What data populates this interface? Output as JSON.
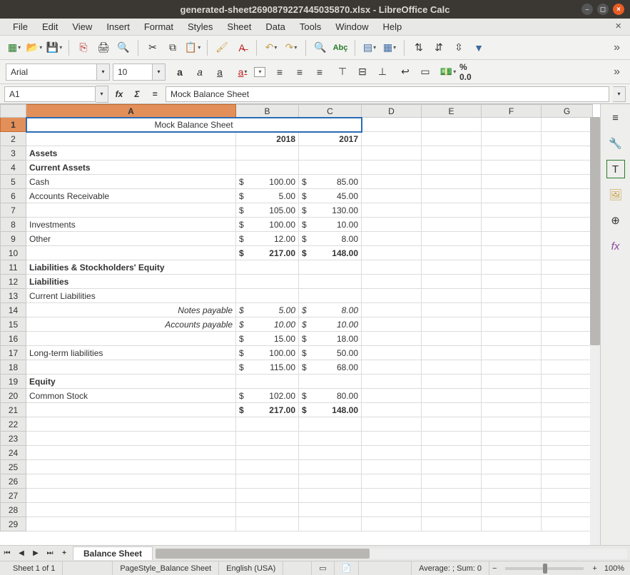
{
  "window": {
    "title": "generated-sheet2690879227445035870.xlsx - LibreOffice Calc"
  },
  "menu": {
    "file": "File",
    "edit": "Edit",
    "view": "View",
    "insert": "Insert",
    "format": "Format",
    "styles": "Styles",
    "sheet": "Sheet",
    "data": "Data",
    "tools": "Tools",
    "window": "Window",
    "help": "Help"
  },
  "font": {
    "name": "Arial",
    "size": "10"
  },
  "percent_label": "% 0.0",
  "namebox": "A1",
  "formula": "Mock Balance Sheet",
  "columns": [
    "A",
    "B",
    "C",
    "D",
    "E",
    "F",
    "G"
  ],
  "active_col": "A",
  "active_row": 1,
  "rows": [
    1,
    2,
    3,
    4,
    5,
    6,
    7,
    8,
    9,
    10,
    11,
    12,
    13,
    14,
    15,
    16,
    17,
    18,
    19,
    20,
    21,
    22,
    23,
    24,
    25,
    26,
    27,
    28,
    29
  ],
  "sheet": {
    "title": "Mock Balance Sheet",
    "years": {
      "b": "2018",
      "c": "2017"
    },
    "assets": "Assets",
    "current_assets": "Current Assets",
    "cash": "Cash",
    "ar": "Accounts Receivable",
    "investments": "Investments",
    "other": "Other",
    "liab_eq": "Liabilities & Stockholders' Equity",
    "liabilities": "Liabilities",
    "cur_liab": "Current Liabilities",
    "notes_pay": "Notes payable",
    "acct_pay": "Accounts payable",
    "lt_liab": "Long-term liabilities",
    "equity": "Equity",
    "common": "Common Stock",
    "sym": "$",
    "v": {
      "cash_b": "100.00",
      "cash_c": "85.00",
      "ar_b": "5.00",
      "ar_c": "45.00",
      "casub_b": "105.00",
      "casub_c": "130.00",
      "inv_b": "100.00",
      "inv_c": "10.00",
      "oth_b": "12.00",
      "oth_c": "8.00",
      "atot_b": "217.00",
      "atot_c": "148.00",
      "np_b": "5.00",
      "np_c": "8.00",
      "ap_b": "10.00",
      "ap_c": "10.00",
      "clsub_b": "15.00",
      "clsub_c": "18.00",
      "lt_b": "100.00",
      "lt_c": "50.00",
      "ltot_b": "115.00",
      "ltot_c": "68.00",
      "cs_b": "102.00",
      "cs_c": "80.00",
      "gtot_b": "217.00",
      "gtot_c": "148.00"
    }
  },
  "tab": "Balance Sheet",
  "status": {
    "sheet": "Sheet 1 of 1",
    "style": "PageStyle_Balance Sheet",
    "lang": "English (USA)",
    "avg": "Average: ; Sum: 0",
    "zoom": "100%"
  }
}
